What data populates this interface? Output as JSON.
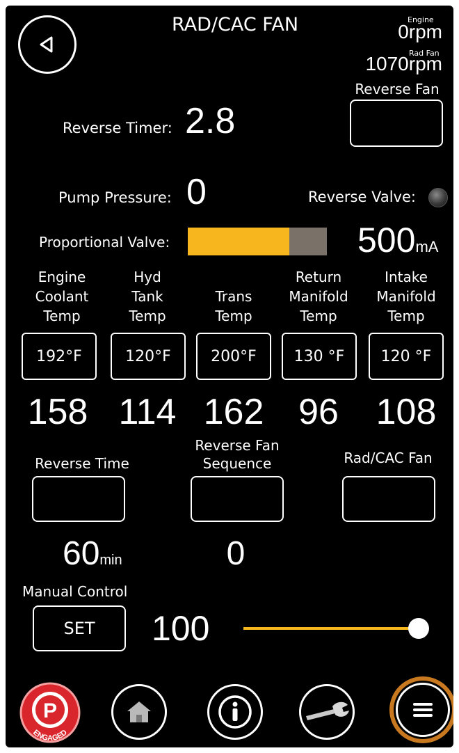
{
  "header": {
    "title": "RAD/CAC FAN",
    "engine_label": "Engine",
    "engine_value": "0",
    "engine_unit": "rpm",
    "radfan_label": "Rad Fan",
    "radfan_value": "1070",
    "radfan_unit": "rpm"
  },
  "reverse_fan": {
    "label": "Reverse Fan"
  },
  "reverse_timer": {
    "label": "Reverse Timer:",
    "value": "2.8"
  },
  "pump_pressure": {
    "label": "Pump Pressure:",
    "value": "0"
  },
  "reverse_valve": {
    "label": "Reverse Valve:"
  },
  "proportional_valve": {
    "label": "Proportional Valve:",
    "value": "500",
    "unit": "mA",
    "fill_fraction": 0.73
  },
  "temps": [
    {
      "line1": "Engine",
      "line2": "Coolant",
      "line3": "Temp",
      "setpoint": "192°F",
      "value": "158"
    },
    {
      "line1": "Hyd",
      "line2": "Tank",
      "line3": "Temp",
      "setpoint": "120°F",
      "value": "114"
    },
    {
      "line1": "",
      "line2": "Trans",
      "line3": "Temp",
      "setpoint": "200°F",
      "value": "162"
    },
    {
      "line1": "Return",
      "line2": "Manifold",
      "line3": "Temp",
      "setpoint": "130 °F",
      "value": "96"
    },
    {
      "line1": "Intake",
      "line2": "Manifold",
      "line3": "Temp",
      "setpoint": "120 °F",
      "value": "108"
    }
  ],
  "reverse_time": {
    "label": "Reverse Time",
    "value": "60",
    "unit": "min"
  },
  "reverse_fan_sequence": {
    "label_line1": "Reverse Fan",
    "label_line2": "Sequence",
    "value": "0"
  },
  "rad_cac_fan": {
    "label": "Rad/CAC Fan"
  },
  "manual_control": {
    "label": "Manual Control",
    "set_label": "SET",
    "value": "100",
    "slider_fraction": 1.0
  },
  "nav": {
    "parking_label": "P",
    "engaged_label": "ENGAGED"
  },
  "colors": {
    "accent": "#f7b51e",
    "valve_remaining": "#7a7268",
    "engaged_red": "#d8262c",
    "menu_ring": "#c8781e"
  }
}
